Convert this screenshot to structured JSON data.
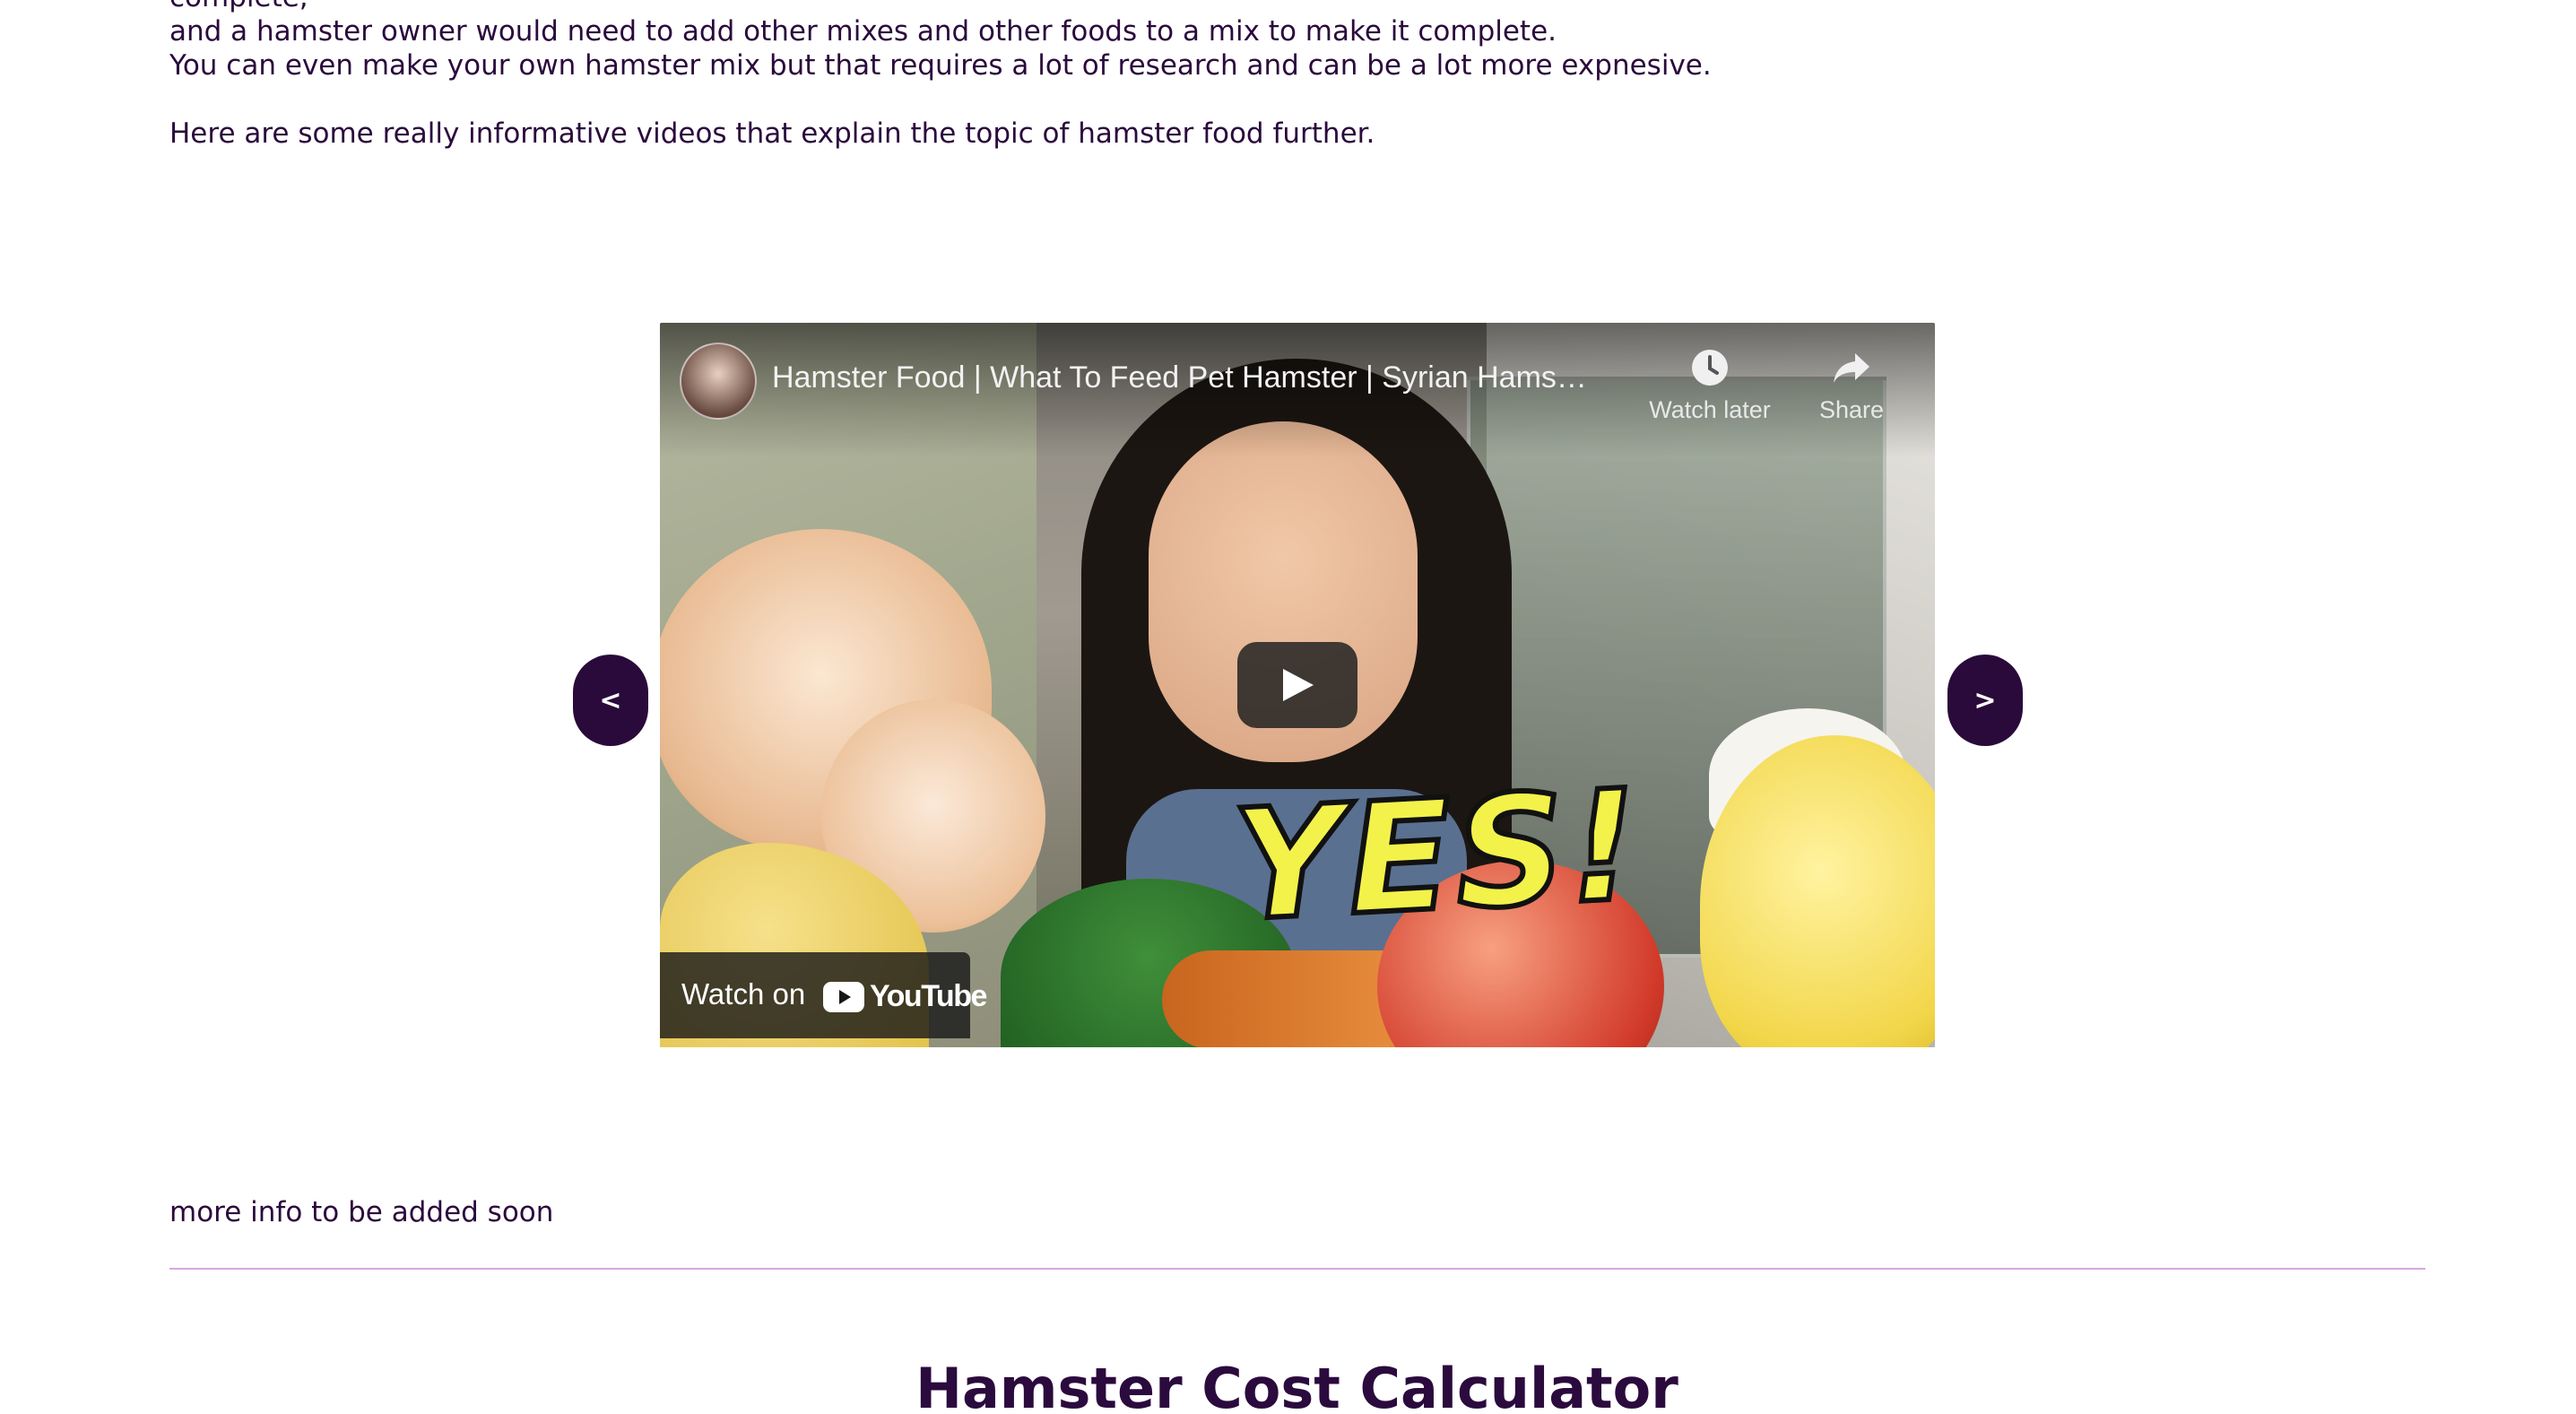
{
  "article": {
    "line_partial": "complete,",
    "line_2": "and a hamster owner would need to add other mixes and other foods to a mix to make it complete.",
    "line_3": "You can even make your own hamster mix but that requires a lot of research and can be a lot more expnesive.",
    "videos_intro": "Here are some really informative videos that explain the topic of hamster food further.",
    "more_info": "more info to be added soon"
  },
  "video": {
    "title": "Hamster Food | What To Feed Pet Hamster | Syrian Hams…",
    "watch_later_label": "Watch later",
    "share_label": "Share",
    "watch_on_label": "Watch on",
    "youtube_logo_text": "YouTube",
    "thumbnail_overlay_text": "YES!"
  },
  "carousel": {
    "prev_label": "<",
    "next_label": ">"
  },
  "calculator": {
    "heading": "Hamster Cost Calculator"
  },
  "colors": {
    "text": "#2b0a3d",
    "nav_button": "#2a0a3a",
    "divider": "#d9a6e0",
    "youtube_red": "#ff0000"
  },
  "icons": [
    "clock-icon",
    "share-arrow-icon",
    "play-icon",
    "youtube-logo-icon"
  ]
}
